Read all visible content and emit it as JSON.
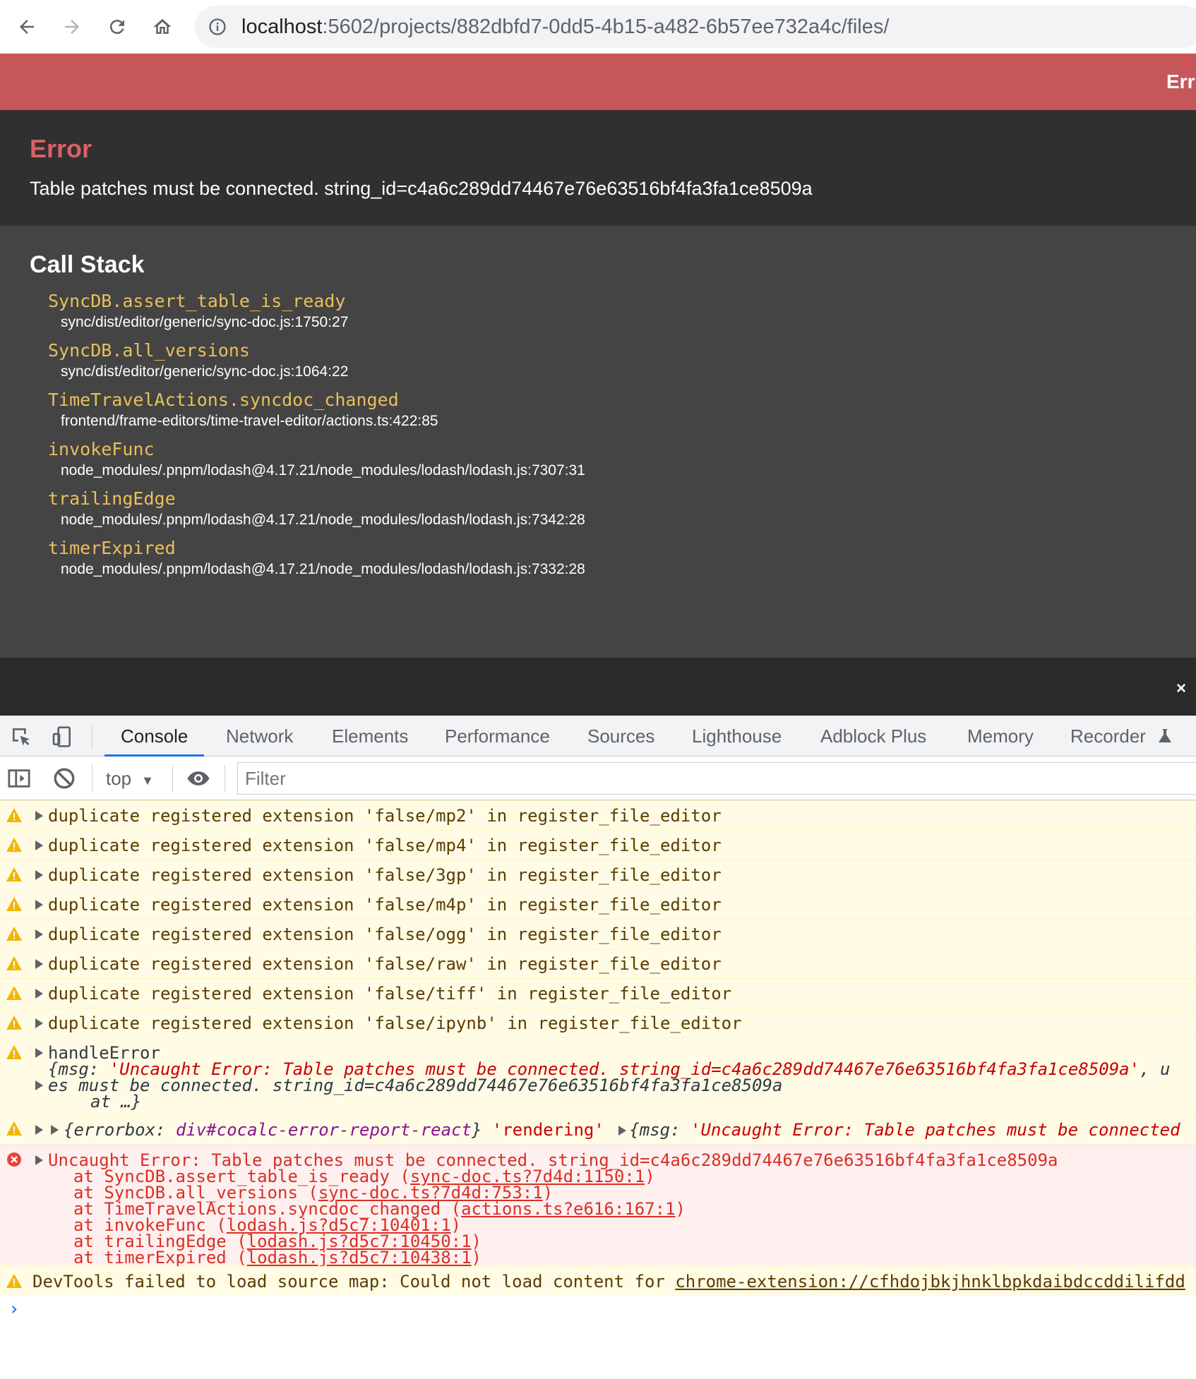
{
  "browser": {
    "url_host": "localhost",
    "url_path": ":5602/projects/882dbfd7-0dd5-4b15-a482-6b57ee732a4c/files/"
  },
  "error_page": {
    "banner_text": "Err",
    "title": "Error",
    "message": "Table patches must be connected. string_id=c4a6c289dd74467e76e63516bf4fa3fa1ce8509a",
    "callstack_title": "Call Stack",
    "frames": [
      {
        "func": "SyncDB.assert_table_is_ready",
        "loc": "sync/dist/editor/generic/sync-doc.js:1750:27"
      },
      {
        "func": "SyncDB.all_versions",
        "loc": "sync/dist/editor/generic/sync-doc.js:1064:22"
      },
      {
        "func": "TimeTravelActions.syncdoc_changed",
        "loc": "frontend/frame-editors/time-travel-editor/actions.ts:422:85"
      },
      {
        "func": "invokeFunc",
        "loc": "node_modules/.pnpm/lodash@4.17.21/node_modules/lodash/lodash.js:7307:31"
      },
      {
        "func": "trailingEdge",
        "loc": "node_modules/.pnpm/lodash@4.17.21/node_modules/lodash/lodash.js:7342:28"
      },
      {
        "func": "timerExpired",
        "loc": "node_modules/.pnpm/lodash@4.17.21/node_modules/lodash/lodash.js:7332:28"
      }
    ],
    "close_label": "×"
  },
  "devtools": {
    "tabs": [
      "Console",
      "Network",
      "Elements",
      "Performance",
      "Sources",
      "Lighthouse",
      "Adblock Plus",
      "Memory",
      "Recorder"
    ],
    "context": "top",
    "filter_placeholder": "Filter",
    "warnings": [
      "duplicate registered extension 'false/mp2' in register_file_editor",
      "duplicate registered extension 'false/mp4' in register_file_editor",
      "duplicate registered extension 'false/3gp' in register_file_editor",
      "duplicate registered extension 'false/m4p' in register_file_editor",
      "duplicate registered extension 'false/ogg' in register_file_editor",
      "duplicate registered extension 'false/raw' in register_file_editor",
      "duplicate registered extension 'false/tiff' in register_file_editor",
      "duplicate registered extension 'false/ipynb' in register_file_editor"
    ],
    "handle_error": {
      "label": "handleError",
      "obj_open": "{msg: ",
      "obj_msg": "'Uncaught Error: Table patches must be connected.  string_id=c4a6c289dd74467e76e63516bf4fa3fa1ce8509a'",
      "obj_tail": ", u",
      "line2": "es must be connected.  string_id=c4a6c289dd74467e76e63516bf4fa3fa1ce8509a",
      "line3": "at …}"
    },
    "render_warning": {
      "errorbox_key": "{errorbox: ",
      "errorbox_val": "div#cocalc-error-report-react",
      "errorbox_close": "}",
      "rendering": "'rendering'",
      "msg_key": "{msg: ",
      "msg_val": "'Uncaught Error: Table patches must be connected"
    },
    "uncaught_error": {
      "message": "Uncaught Error: Table patches must be connected.  string_id=c4a6c289dd74467e76e63516bf4fa3fa1ce8509a",
      "stack": [
        {
          "func": "SyncDB.assert_table_is_ready",
          "link": "sync-doc.ts?7d4d:1150:1"
        },
        {
          "func": "SyncDB.all_versions",
          "link": "sync-doc.ts?7d4d:753:1"
        },
        {
          "func": "TimeTravelActions.syncdoc_changed",
          "link": "actions.ts?e616:167:1"
        },
        {
          "func": "invokeFunc",
          "link": "lodash.js?d5c7:10401:1"
        },
        {
          "func": "trailingEdge",
          "link": "lodash.js?d5c7:10450:1"
        },
        {
          "func": "timerExpired",
          "link": "lodash.js?d5c7:10438:1"
        }
      ]
    },
    "sourcemap_warning": {
      "text": "DevTools failed to load source map: Could not load content for ",
      "link": "chrome-extension://cfhdojbkjhnklbpkdaibdccddilifdd"
    },
    "prompt": "›"
  }
}
